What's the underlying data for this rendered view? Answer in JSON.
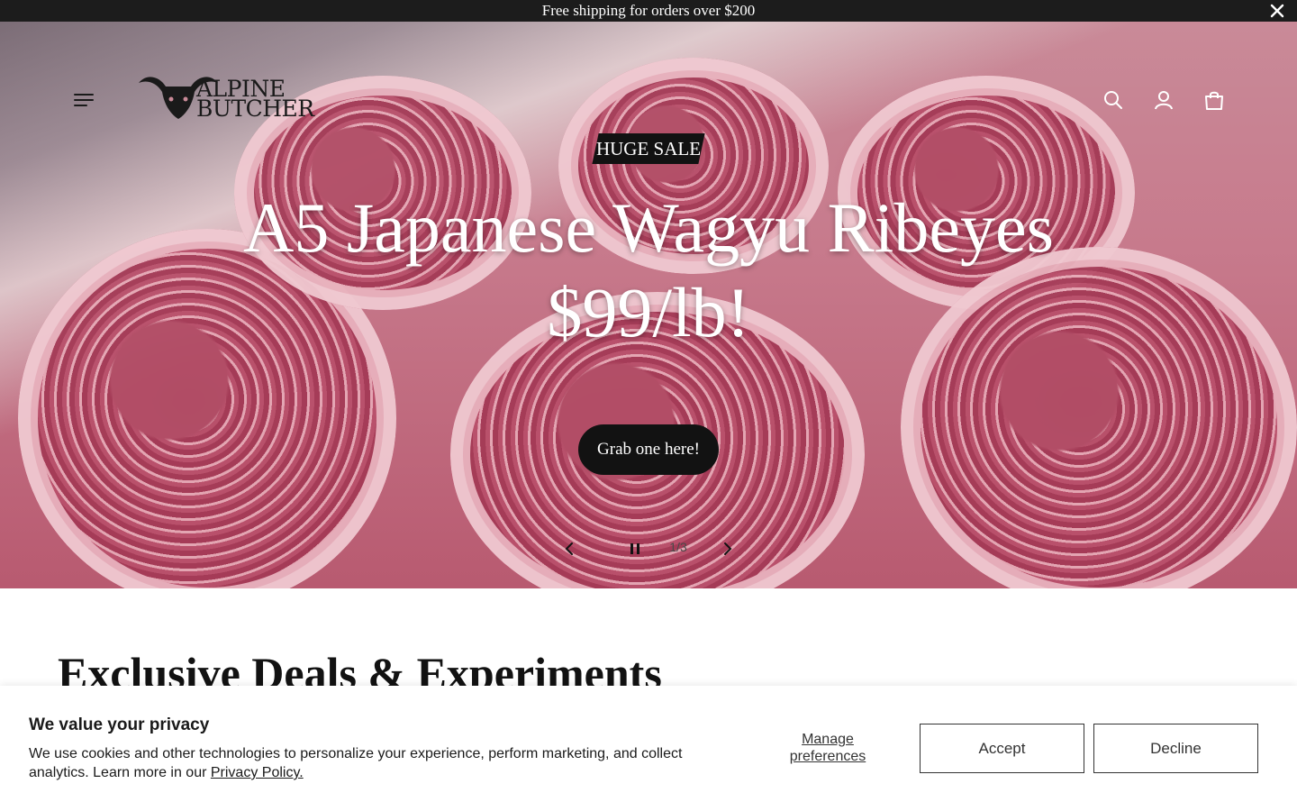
{
  "announcement": {
    "text": "Free shipping for orders over $200",
    "close_icon": "close-icon"
  },
  "header": {
    "logo": {
      "line1": "ALPINE",
      "line2": "BUTCHER",
      "icon": "bull-head-icon"
    },
    "icons": [
      "menu-icon",
      "search-icon",
      "account-icon",
      "cart-icon"
    ]
  },
  "hero": {
    "badge": "HUGE SALE",
    "title_line1": "A5 Japanese Wagyu Ribeyes",
    "title_line2": "$99/lb!",
    "cta": "Grab one here!",
    "slide_counter": "1/3",
    "controls": [
      "chevron-left-icon",
      "pause-icon",
      "chevron-right-icon"
    ]
  },
  "section": {
    "title": "Exclusive Deals & Experiments"
  },
  "cookie_banner": {
    "title": "We value your privacy",
    "body": "We use cookies and other technologies to personalize your experience, perform marketing, and collect analytics. Learn more in our ",
    "link": "Privacy Policy.",
    "manage_label": "Manage preferences",
    "accept_label": "Accept",
    "decline_label": "Decline"
  },
  "colors": {
    "dark": "#121212",
    "announcement_bg": "#1c1c1c",
    "white": "#ffffff"
  }
}
